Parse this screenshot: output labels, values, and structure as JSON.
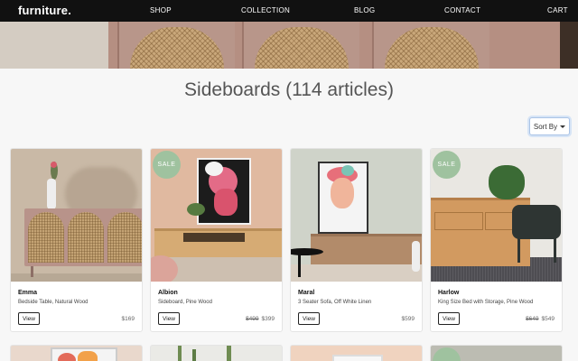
{
  "nav": {
    "brand": "furniture.",
    "links": [
      "SHOP",
      "COLLECTION",
      "BLOG",
      "CONTACT",
      "CART"
    ]
  },
  "page": {
    "title": "Sideboards (114 articles)"
  },
  "sort": {
    "label": "Sort By"
  },
  "products": [
    {
      "name": "Emma",
      "desc": "Bedside Table, Natural Wood",
      "button": "View",
      "price": "$169",
      "old_price": "",
      "badge": ""
    },
    {
      "name": "Albion",
      "desc": "Sideboard, Pine Wood",
      "button": "View",
      "price": "$399",
      "old_price": "$499",
      "badge": "SALE"
    },
    {
      "name": "Maral",
      "desc": "3 Seater Sofa, Off White Linen",
      "button": "View",
      "price": "$599",
      "old_price": "",
      "badge": ""
    },
    {
      "name": "Harlow",
      "desc": "King Size Bed with Storage, Pine Wood",
      "button": "View",
      "price": "$549",
      "old_price": "$649",
      "badge": "SALE"
    }
  ],
  "colors": {
    "nav_bg": "#111111",
    "sale_badge": "#9fc29f",
    "page_bg": "#f7f7f7"
  }
}
